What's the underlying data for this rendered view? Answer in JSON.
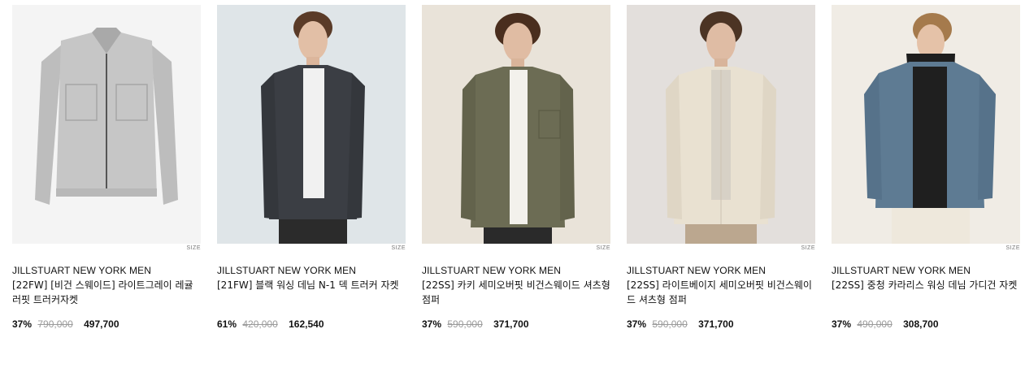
{
  "products": [
    {
      "brand": "JILLSTUART NEW YORK MEN",
      "name": "[22FW] [비건 스웨이드] 라이트그레이 레귤러핏 트러커자켓",
      "size_label": "SIZE",
      "discount": "37%",
      "original_price": "790,000",
      "sale_price": "497,700",
      "image_icon": "flat-jacket-image",
      "colors": {
        "bg": "#f2f2f2",
        "garment": "#c4c4c4"
      }
    },
    {
      "brand": "JILLSTUART NEW YORK MEN",
      "name": "[21FW] 블랙 워싱 데님 N-1 덱 트러커 자켓",
      "size_label": "SIZE",
      "discount": "61%",
      "original_price": "420,000",
      "sale_price": "162,540",
      "image_icon": "model-jacket-image",
      "colors": {
        "bg": "#dde3e6",
        "garment": "#3a3d42"
      }
    },
    {
      "brand": "JILLSTUART NEW YORK MEN",
      "name": "[22SS] 카키 세미오버핏 비건스웨이드 셔츠형 점퍼",
      "size_label": "SIZE",
      "discount": "37%",
      "original_price": "590,000",
      "sale_price": "371,700",
      "image_icon": "model-jacket-image",
      "colors": {
        "bg": "#e8e2d8",
        "garment": "#6b6b52"
      }
    },
    {
      "brand": "JILLSTUART NEW YORK MEN",
      "name": "[22SS] 라이트베이지 세미오버핏 비건스웨이드 셔츠형 점퍼",
      "size_label": "SIZE",
      "discount": "37%",
      "original_price": "590,000",
      "sale_price": "371,700",
      "image_icon": "model-jacket-image",
      "colors": {
        "bg": "#e2dedb",
        "garment": "#e8e0d0"
      }
    },
    {
      "brand": "JILLSTUART NEW YORK MEN",
      "name": "[22SS] 중청 카라리스 워싱 데님 가디건 자켓",
      "size_label": "SIZE",
      "discount": "37%",
      "original_price": "490,000",
      "sale_price": "308,700",
      "image_icon": "model-jacket-image",
      "colors": {
        "bg": "#efebe4",
        "garment": "#5d7a92"
      }
    }
  ]
}
